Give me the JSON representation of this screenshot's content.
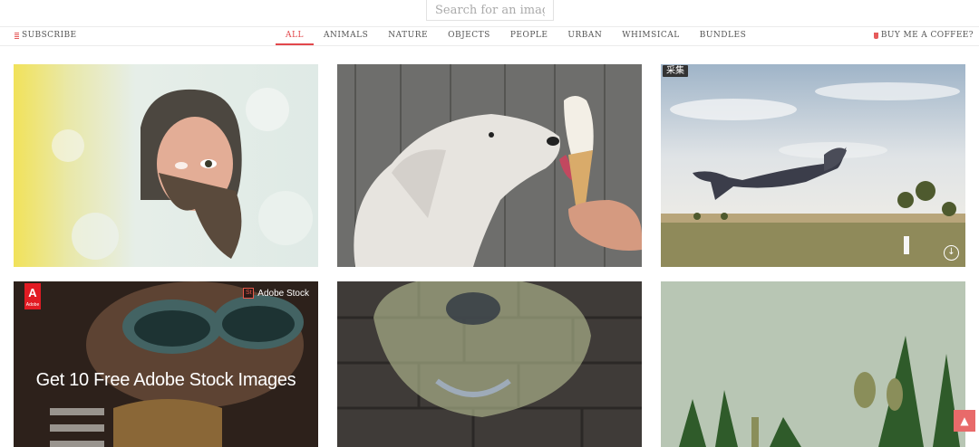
{
  "search": {
    "placeholder": "Search for an image"
  },
  "nav": {
    "subscribe": "SUBSCRIBE",
    "tabs": [
      {
        "label": "ALL",
        "active": true
      },
      {
        "label": "ANIMALS"
      },
      {
        "label": "NATURE"
      },
      {
        "label": "OBJECTS"
      },
      {
        "label": "PEOPLE"
      },
      {
        "label": "URBAN"
      },
      {
        "label": "WHIMSICAL"
      },
      {
        "label": "BUNDLES"
      }
    ],
    "coffee": "BUY ME A COFFEE?"
  },
  "gallery": {
    "collect_badge": "采集",
    "ad": {
      "logo_text": "Adobe",
      "stock_label": "Adobe Stock",
      "headline": "Get 10 Free Adobe Stock Images"
    }
  },
  "colors": {
    "accent": "#e2474b",
    "scroll_top_button": "#e86a6a"
  },
  "icons": {
    "subscribe": "list-icon",
    "coffee": "coffee-cup-icon",
    "download": "download-circle-icon",
    "back_to_top": "chevron-up-icon"
  }
}
